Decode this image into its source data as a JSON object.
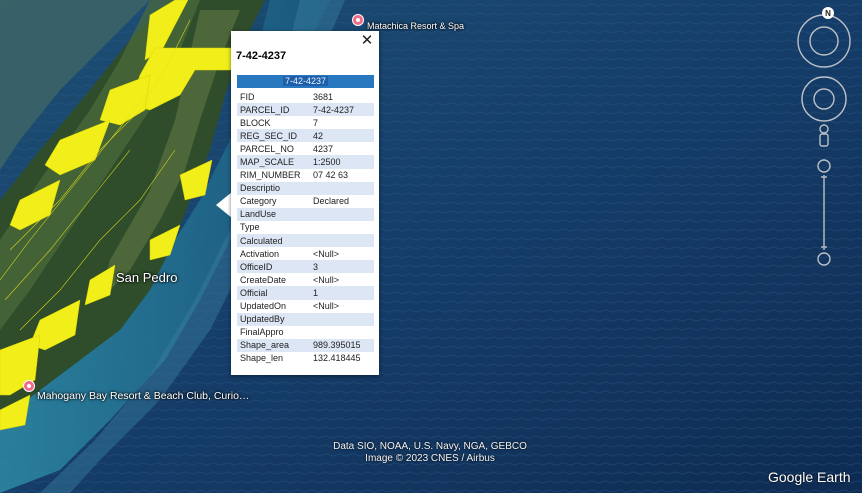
{
  "map": {
    "places": [
      {
        "id": "matachica",
        "label": "Matachica Resort & Spa"
      },
      {
        "id": "san-pedro",
        "label": "San Pedro"
      },
      {
        "id": "mahogany",
        "label": "Mahogany Bay Resort & Beach Club, Curio…"
      }
    ],
    "attribution_line1": "Data SIO, NOAA, U.S. Navy, NGA, GEBCO",
    "attribution_line2": "Image © 2023 CNES / Airbus",
    "logo": "Google Earth",
    "compass_label": "N"
  },
  "popup": {
    "title": "7-42-4237",
    "header": "7-42-4237",
    "close_icon": "close-icon",
    "rows": [
      {
        "key": "FID",
        "value": "3681"
      },
      {
        "key": "PARCEL_ID",
        "value": "7-42-4237"
      },
      {
        "key": "BLOCK",
        "value": "7"
      },
      {
        "key": "REG_SEC_ID",
        "value": "42"
      },
      {
        "key": "PARCEL_NO",
        "value": "4237"
      },
      {
        "key": "MAP_SCALE",
        "value": "1:2500"
      },
      {
        "key": "RIM_NUMBER",
        "value": "07 42 63"
      },
      {
        "key": "Descriptio",
        "value": ""
      },
      {
        "key": "Category",
        "value": "Declared"
      },
      {
        "key": "LandUse",
        "value": ""
      },
      {
        "key": "Type",
        "value": ""
      },
      {
        "key": "Calculated",
        "value": ""
      },
      {
        "key": "Activation",
        "value": "<Null>"
      },
      {
        "key": "OfficeID",
        "value": "3"
      },
      {
        "key": "CreateDate",
        "value": "<Null>"
      },
      {
        "key": "Official",
        "value": "1"
      },
      {
        "key": "UpdatedOn",
        "value": "<Null>"
      },
      {
        "key": "UpdatedBy",
        "value": ""
      },
      {
        "key": "FinalAppro",
        "value": ""
      },
      {
        "key": "Shape_area",
        "value": "989.395015"
      },
      {
        "key": "Shape_len",
        "value": "132.418445"
      }
    ]
  },
  "colors": {
    "ocean": "#133a63",
    "parcel_highlight": "#f2ee1a",
    "pin": "#f06a8a",
    "header_blue": "#2878c0",
    "row_alt": "#dde6f5"
  }
}
